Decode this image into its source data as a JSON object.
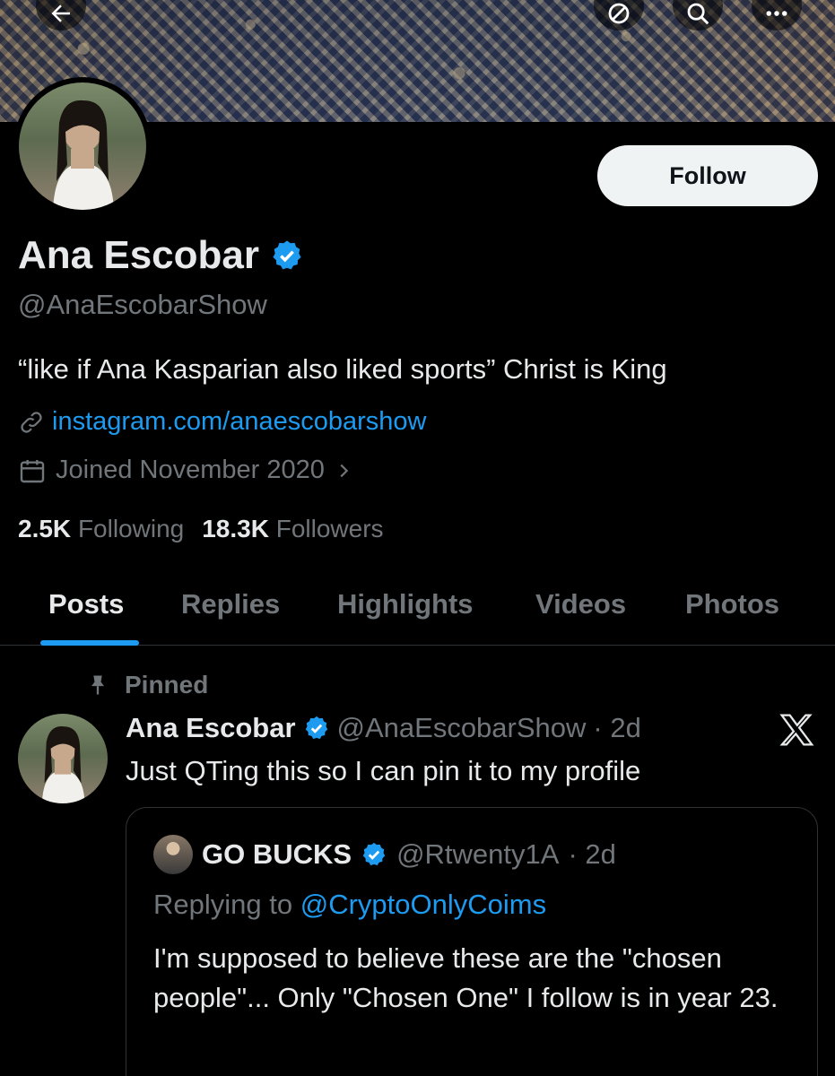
{
  "profile": {
    "name": "Ana Escobar",
    "handle": "@AnaEscobarShow",
    "bio": "“like if Ana Kasparian also liked sports” Christ is King",
    "link": "instagram.com/anaescobarshow",
    "joined": "Joined November 2020",
    "following_count": "2.5K",
    "following_label": "Following",
    "followers_count": "18.3K",
    "followers_label": "Followers",
    "follow_label": "Follow",
    "verified_color": "#1d9bf0"
  },
  "tabs": [
    {
      "label": "Posts",
      "active": true
    },
    {
      "label": "Replies"
    },
    {
      "label": "Highlights"
    },
    {
      "label": "Videos"
    },
    {
      "label": "Photos"
    }
  ],
  "pinned_post": {
    "pinned_label": "Pinned",
    "author_name": "Ana Escobar",
    "author_handle": "@AnaEscobarShow",
    "time": "· 2d",
    "text": "Just QTing this so I can pin it to my profile",
    "quote": {
      "author_name": "GO BUCKS",
      "author_handle": "@Rtwenty1A",
      "time": "· 2d",
      "replying_prefix": "Replying to",
      "replying_to": "@CryptoOnlyCoims",
      "text": "I'm supposed to believe these are the \"chosen people\"... Only \"Chosen One\" I follow is in year 23."
    }
  },
  "icons": {
    "back": "back-arrow-icon",
    "topic": "topic-icon",
    "search": "search-icon",
    "more": "more-icon"
  }
}
